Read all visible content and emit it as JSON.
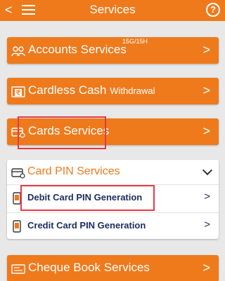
{
  "header": {
    "back": "<",
    "title": "Services",
    "help": "?"
  },
  "rows": [
    {
      "label": "Accounts Services",
      "badge": "15G/15H",
      "icon": "people-icon"
    },
    {
      "label": "Cardless Cash",
      "sub": "Withdrawal",
      "icon": "rupee-note-icon"
    },
    {
      "label": "Cards Services",
      "icon": "card-icon"
    }
  ],
  "pin": {
    "title": "Card PIN Services",
    "items": [
      {
        "label": "Debit Card PIN Generation"
      },
      {
        "label": "Credit Card PIN Generation"
      }
    ]
  },
  "cheque": {
    "label": "Cheque Book Services"
  },
  "chevron": ">",
  "colors": {
    "accent": "#ee7a1c",
    "highlight": "#e53945",
    "navy": "#1d2c5e"
  }
}
